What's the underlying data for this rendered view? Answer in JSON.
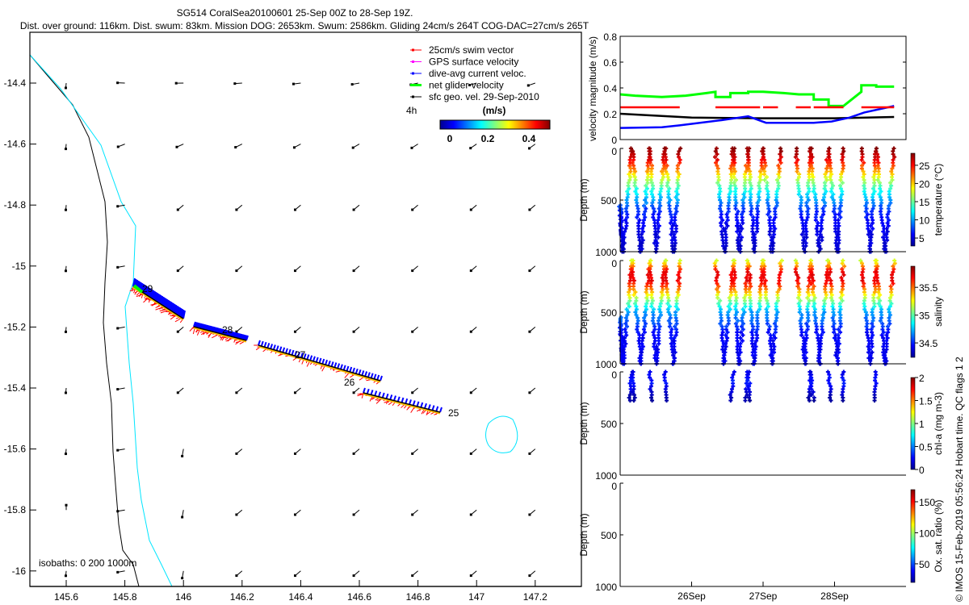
{
  "title": {
    "line1": "SG514 CoralSea20100601 25-Sep 00Z to 28-Sep 19Z.",
    "line2": "Dist. over ground: 116km. Dist. swum: 83km. Mission DOG: 2653km. Swum: 2586km. Gliding 24cm/s 264T COG-DAC=27cm/s 265T"
  },
  "credit": "© IMOS 15-Feb-2019 05:56:24 Hobart time. QC flags 1  2",
  "map": {
    "xlim": [
      145.476,
      147.358
    ],
    "ylim": [
      -16.05,
      -14.233
    ],
    "x_ticks": [
      "145.6",
      "145.8",
      "146",
      "146.2",
      "146.4",
      "146.6",
      "146.8",
      "147",
      "147.2"
    ],
    "y_ticks": [
      "-14.4",
      "-14.6",
      "-14.8",
      "-15",
      "-15.2",
      "-15.4",
      "-15.6",
      "-15.8",
      "-16"
    ],
    "legend": [
      {
        "label": "25cm/s swim vector",
        "color": "#ff0000"
      },
      {
        "label": "GPS surface velocity",
        "color": "#ff00ff"
      },
      {
        "label": "dive-avg current veloc.",
        "color": "#0000ff"
      },
      {
        "label": "net glider velocity",
        "color": "#00ff00"
      },
      {
        "label": "sfc geo. vel. 29-Sep-2010",
        "color": "#000000"
      }
    ],
    "scale_label": "4h",
    "colorbar": {
      "label": "(m/s)",
      "range": [
        -0.05,
        0.506
      ],
      "ticks": [
        "0",
        "0.2",
        "0.4"
      ]
    },
    "isobaths_label": "isobaths: 0   200  1000m",
    "isobath_colors": {
      "200": "#000000",
      "1000": "#00ffff"
    },
    "day_labels": [
      "25",
      "26",
      "27",
      "28",
      "29"
    ]
  },
  "chart_data": [
    {
      "type": "line",
      "ylabel": "velocity magnitude (m/s)",
      "ylim": [
        0,
        0.8
      ],
      "y_ticks": [
        "0",
        "0.2",
        "0.4",
        "0.6",
        "0.8"
      ],
      "xlim": [
        "2010-09-25T00",
        "2010-09-29T00"
      ],
      "series": [
        {
          "color": "#00ff00",
          "points": [
            [
              "2010-09-25T00",
              0.35
            ],
            [
              "2010-09-25T05",
              0.34
            ],
            [
              "2010-09-25T14",
              0.33
            ],
            [
              "2010-09-25T22",
              0.34
            ],
            [
              "2010-09-26T05",
              0.36
            ],
            [
              "2010-09-26T08",
              0.37
            ],
            [
              "2010-09-26T08",
              0.33
            ],
            [
              "2010-09-26T13",
              0.33
            ],
            [
              "2010-09-26T13",
              0.36
            ],
            [
              "2010-09-26T19",
              0.36
            ],
            [
              "2010-09-26T19",
              0.37
            ],
            [
              "2010-09-27T00",
              0.37
            ],
            [
              "2010-09-27T07",
              0.36
            ],
            [
              "2010-09-27T12",
              0.35
            ],
            [
              "2010-09-27T17",
              0.35
            ],
            [
              "2010-09-27T17",
              0.31
            ],
            [
              "2010-09-27T22",
              0.31
            ],
            [
              "2010-09-27T22",
              0.26
            ],
            [
              "2010-09-28T03",
              0.26
            ],
            [
              "2010-09-28T09",
              0.37
            ],
            [
              "2010-09-28T09",
              0.42
            ],
            [
              "2010-09-28T14",
              0.42
            ],
            [
              "2010-09-28T14",
              0.41
            ],
            [
              "2010-09-28T20",
              0.41
            ]
          ]
        },
        {
          "color": "#000000",
          "points": [
            [
              "2010-09-25T00",
              0.2
            ],
            [
              "2010-09-26T00",
              0.17
            ],
            [
              "2010-09-27T00",
              0.165
            ],
            [
              "2010-09-28T00",
              0.165
            ],
            [
              "2010-09-28T20",
              0.175
            ]
          ]
        },
        {
          "color": "#0000ff",
          "points": [
            [
              "2010-09-25T00",
              0.09
            ],
            [
              "2010-09-25T14",
              0.095
            ],
            [
              "2010-09-25T20",
              0.11
            ],
            [
              "2010-09-26T10",
              0.15
            ],
            [
              "2010-09-26T19",
              0.18
            ],
            [
              "2010-09-27T01",
              0.13
            ],
            [
              "2010-09-27T17",
              0.13
            ],
            [
              "2010-09-27T23",
              0.14
            ],
            [
              "2010-09-28T05",
              0.17
            ],
            [
              "2010-09-28T10",
              0.21
            ],
            [
              "2010-09-28T20",
              0.26
            ]
          ]
        }
      ],
      "swim_segments": {
        "color": "#ff0000",
        "value": 0.25,
        "ranges": [
          [
            "2010-09-25T00",
            "2010-09-25T20"
          ],
          [
            "2010-09-26T08",
            "2010-09-26T23"
          ],
          [
            "2010-09-27T00",
            "2010-09-27T05"
          ],
          [
            "2010-09-27T11",
            "2010-09-27T16"
          ],
          [
            "2010-09-27T17",
            "2010-09-28T03"
          ],
          [
            "2010-09-28T09",
            "2010-09-28T20"
          ]
        ]
      }
    },
    {
      "type": "scatter",
      "x_ticks": [
        "26Sep",
        "27Sep",
        "28Sep"
      ],
      "ylabel": "Depth (m)",
      "ylim": [
        1000,
        0
      ],
      "y_ticks": [
        "0",
        "500",
        "1000"
      ],
      "dive_groups": [
        [
          [
            "2010-09-25T00",
            550
          ],
          [
            "2010-09-25T01",
            1000
          ],
          [
            "2010-09-25T04",
            0
          ],
          [
            "2010-09-25T07",
            1000
          ],
          [
            "2010-09-25T10",
            0
          ],
          [
            "2010-09-25T12",
            1000
          ],
          [
            "2010-09-25T15",
            0
          ],
          [
            "2010-09-25T18",
            1000
          ],
          [
            "2010-09-25T20",
            0
          ]
        ],
        [
          [
            "2010-09-26T08",
            0
          ],
          [
            "2010-09-26T11",
            1000
          ],
          [
            "2010-09-26T14",
            0
          ],
          [
            "2010-09-26T16",
            1000
          ],
          [
            "2010-09-26T19",
            0
          ],
          [
            "2010-09-26T21",
            1000
          ],
          [
            "2010-09-27T00",
            0
          ],
          [
            "2010-09-27T03",
            1000
          ],
          [
            "2010-09-27T06",
            0
          ]
        ],
        [
          [
            "2010-09-27T11",
            0
          ],
          [
            "2010-09-27T14",
            1000
          ],
          [
            "2010-09-27T16",
            0
          ],
          [
            "2010-09-27T19",
            1000
          ],
          [
            "2010-09-27T22",
            0
          ],
          [
            "2010-09-28T01",
            1000
          ],
          [
            "2010-09-28T03",
            0
          ]
        ],
        [
          [
            "2010-09-28T09",
            0
          ],
          [
            "2010-09-28T12",
            1000
          ],
          [
            "2010-09-28T14",
            0
          ],
          [
            "2010-09-28T17",
            1000
          ],
          [
            "2010-09-28T20",
            0
          ]
        ]
      ],
      "panels": [
        {
          "variable": "temperature",
          "colorbar_label": "temperature (°C)",
          "crange": [
            2.8,
            28.3
          ],
          "cticks": [
            "5",
            "10",
            "15",
            "20",
            "25"
          ],
          "profile": [
            [
              0,
              28
            ],
            [
              100,
              26
            ],
            [
              200,
              22
            ],
            [
              300,
              17
            ],
            [
              400,
              13
            ],
            [
              500,
              10
            ],
            [
              600,
              7
            ],
            [
              700,
              6
            ],
            [
              800,
              5.5
            ],
            [
              1000,
              4.5
            ]
          ]
        },
        {
          "variable": "salinity",
          "colorbar_label": "salinity",
          "crange": [
            34.24,
            35.88
          ],
          "cticks": [
            "34.5",
            "35",
            "35.5"
          ],
          "profile": [
            [
              0,
              35.2
            ],
            [
              100,
              35.7
            ],
            [
              200,
              35.7
            ],
            [
              300,
              35.4
            ],
            [
              400,
              35.0
            ],
            [
              500,
              34.7
            ],
            [
              700,
              34.45
            ],
            [
              1000,
              34.4
            ]
          ]
        },
        {
          "variable": "chl-a",
          "colorbar_label": "chl-a (mg m-3)",
          "crange": [
            0,
            2
          ],
          "cticks": [
            "0",
            "0.5",
            "1",
            "1.5",
            "2"
          ],
          "max_depth": 280,
          "profile": [
            [
              0,
              0.2
            ],
            [
              100,
              0.3
            ],
            [
              200,
              0.15
            ],
            [
              300,
              0.05
            ]
          ]
        },
        {
          "variable": "oxygen",
          "colorbar_label": "Ox. sat. ratio (%)",
          "crange": [
            20,
            169.5
          ],
          "cticks": [
            "50",
            "100",
            "150"
          ],
          "profile": []
        }
      ]
    }
  ]
}
